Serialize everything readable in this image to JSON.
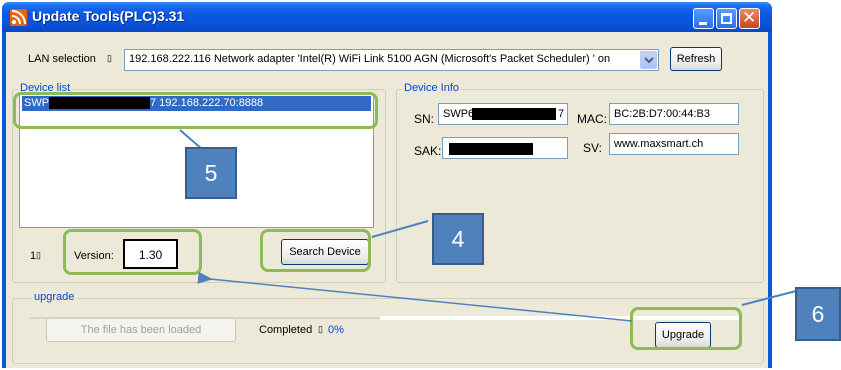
{
  "window": {
    "title": "Update Tools(PLC)3.31",
    "icon": "rss-feed-icon"
  },
  "lan": {
    "label": "LAN selection",
    "selected": "192.168.222.116 Network adapter 'Intel(R) WiFi Link 5100 AGN (Microsoft's Packet Scheduler) ' on",
    "refresh_label": "Refresh"
  },
  "device_list": {
    "title": "Device list",
    "items": [
      {
        "prefix": "SWP6",
        "suffix": "7 192.168.222.70:8888",
        "selected": true
      }
    ],
    "search_label": "Search Device",
    "index_label": "1",
    "version_label": "Version:",
    "version_value": "1.30"
  },
  "device_info": {
    "title": "Device Info",
    "sn_label": "SN:",
    "sn_prefix": "SWP6",
    "sn_suffix": "7",
    "mac_label": "MAC:",
    "mac_value": "BC:2B:D7:00:44:B3",
    "sak_label": "SAK:",
    "sv_label": "SV:",
    "sv_value": "www.maxsmart.ch"
  },
  "upgrade": {
    "title": "upgrade",
    "file_button": "The file has been loaded",
    "completed_label": "Completed",
    "completed_value": "0%",
    "upgrade_button": "Upgrade"
  },
  "callouts": [
    "5",
    "4",
    "6"
  ],
  "colors": {
    "titlebar": "#0a52d8",
    "selection": "#316ac5",
    "highlight_outline": "#8dbb55",
    "callout_fill": "#4f81bd",
    "group_title": "#0046d5"
  }
}
